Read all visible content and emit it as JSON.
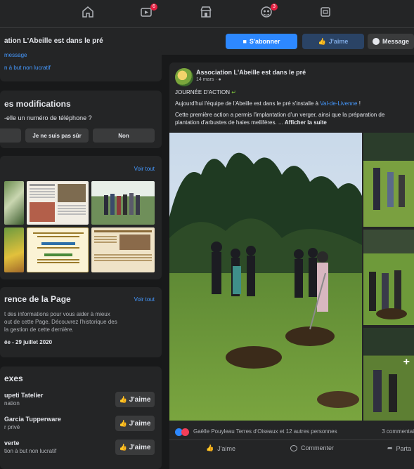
{
  "nav": {
    "icons": [
      "home-icon",
      "watch-icon",
      "marketplace-icon",
      "groups-icon",
      "gaming-icon"
    ],
    "badge_watch": "6",
    "badge_groups": "3"
  },
  "header": {
    "page_name": "ation L'Abeille est dans le pré",
    "subscribe_label": "S'abonner",
    "like_label": "J'aime",
    "message_label": "Message"
  },
  "left": {
    "intro_link": "message",
    "intro_category": "n à but non lucratif",
    "modifications": {
      "title": "es modifications",
      "question": "-elle un numéro de téléphone ?",
      "opt_yes": "",
      "opt_unsure": "Je ne suis pas sûr",
      "opt_no": "Non"
    },
    "photos": {
      "see_all": "Voir tout"
    },
    "transparency": {
      "title": "rence de la Page",
      "see_all": "Voir tout",
      "line1": "t des informations pour vous aider à mieux",
      "line2": "out de cette Page. Découvrez l'historique des",
      "line3": "la gestion de cette dernière.",
      "date": "ée - 29 juillet 2020"
    },
    "related": {
      "title": "exes",
      "items": [
        {
          "name": "upeti Tatelier",
          "category": "nation",
          "like": "J'aime"
        },
        {
          "name": "Garcia Tupperware",
          "category": "r privé",
          "like": "J'aime"
        },
        {
          "name": "verte",
          "category": "tion à but non lucratif",
          "like": "J'aime"
        }
      ]
    }
  },
  "post": {
    "author": "Association L'Abeille est dans le pré",
    "date": "14 mars · ",
    "headline": "JOURNÉE D'ACTION",
    "line1_before": "Aujourd'hui l'équipe de l'Abeille est dans le pré s'installe à ",
    "line1_link": "Val-de-Livenne",
    "line1_after": " !",
    "line2": "Cette première action a permis l'implantation d'un verger, ainsi que la préparation de",
    "line3": "plantation d'arbustes de haies mellifères. ...",
    "see_more": "Afficher la suite",
    "overlay_more": "+",
    "reactions_text": "Gaëlle Pouyleau Terres d'Oiseaux et 12 autres personnes",
    "comments_count": "3 commentai",
    "action_like": "J'aime",
    "action_comment": "Commenter",
    "action_share": "Parta"
  },
  "colors": {
    "background": "#18191a",
    "card": "#242526",
    "accent": "#2d88ff",
    "link": "#4599ff"
  }
}
